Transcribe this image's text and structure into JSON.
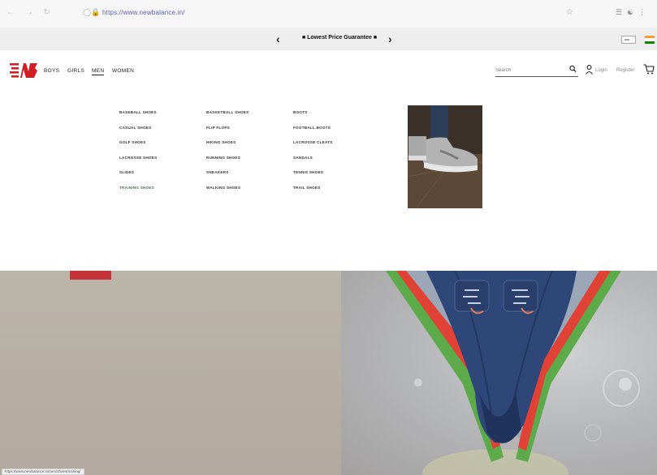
{
  "browser": {
    "url": "https://www.newbalance.in/",
    "accent_color": "#5a5ab0"
  },
  "promo": {
    "text": "■ Lowest Price Guarantee ■"
  },
  "header": {
    "nav": [
      "BOYS",
      "GIRLS",
      "MEN",
      "WOMEN"
    ],
    "active_nav": "MEN",
    "search_placeholder": "Search",
    "login": "Login",
    "register": "Register",
    "logo_color": "#cf2027"
  },
  "menu": {
    "columns": [
      [
        "BASEBALL SHOES",
        "CASUAL SHOES",
        "GOLF SHOES",
        "LACROSSE SHOES",
        "SLIDES",
        "TRAINING SHOES"
      ],
      [
        "BASKETBALL SHOES",
        "FLIP FLOPS",
        "HIKING SHOES",
        "RUNNING SHOES",
        "SNEAKERS",
        "WALKING SHOES"
      ],
      [
        "BOOTS",
        "FOOTBALL BOOTS",
        "LACROSSE CLEATS",
        "SANDALS",
        "TENNIS SHOES",
        "TRAIL SHOES"
      ]
    ],
    "highlight_item": "TRAINING SHOES",
    "highlight_color": "#3f7a3f"
  },
  "status_url": "https://www.newbalance.in/men/shoes/training/"
}
